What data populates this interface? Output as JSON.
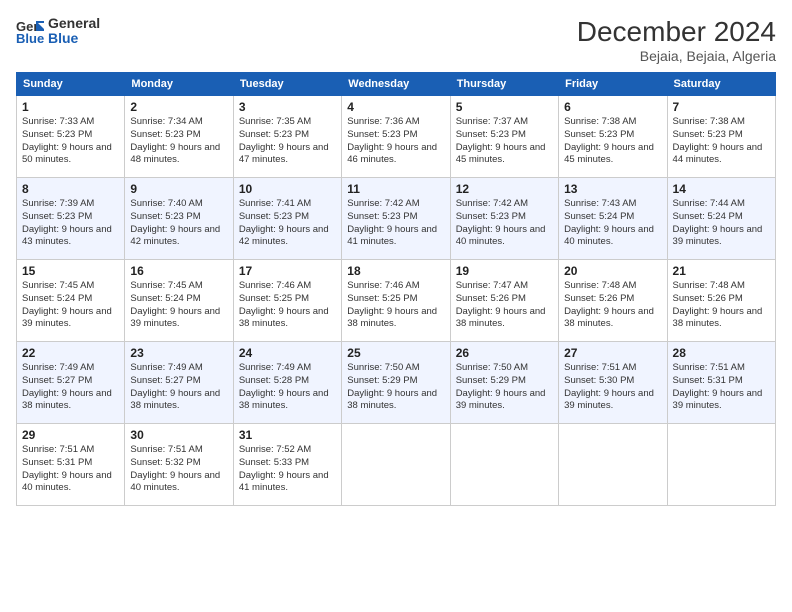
{
  "logo": {
    "line1": "General",
    "line2": "Blue"
  },
  "header": {
    "month": "December 2024",
    "location": "Bejaia, Bejaia, Algeria"
  },
  "weekdays": [
    "Sunday",
    "Monday",
    "Tuesday",
    "Wednesday",
    "Thursday",
    "Friday",
    "Saturday"
  ],
  "weeks": [
    [
      {
        "day": "1",
        "sunrise": "Sunrise: 7:33 AM",
        "sunset": "Sunset: 5:23 PM",
        "daylight": "Daylight: 9 hours and 50 minutes."
      },
      {
        "day": "2",
        "sunrise": "Sunrise: 7:34 AM",
        "sunset": "Sunset: 5:23 PM",
        "daylight": "Daylight: 9 hours and 48 minutes."
      },
      {
        "day": "3",
        "sunrise": "Sunrise: 7:35 AM",
        "sunset": "Sunset: 5:23 PM",
        "daylight": "Daylight: 9 hours and 47 minutes."
      },
      {
        "day": "4",
        "sunrise": "Sunrise: 7:36 AM",
        "sunset": "Sunset: 5:23 PM",
        "daylight": "Daylight: 9 hours and 46 minutes."
      },
      {
        "day": "5",
        "sunrise": "Sunrise: 7:37 AM",
        "sunset": "Sunset: 5:23 PM",
        "daylight": "Daylight: 9 hours and 45 minutes."
      },
      {
        "day": "6",
        "sunrise": "Sunrise: 7:38 AM",
        "sunset": "Sunset: 5:23 PM",
        "daylight": "Daylight: 9 hours and 45 minutes."
      },
      {
        "day": "7",
        "sunrise": "Sunrise: 7:38 AM",
        "sunset": "Sunset: 5:23 PM",
        "daylight": "Daylight: 9 hours and 44 minutes."
      }
    ],
    [
      {
        "day": "8",
        "sunrise": "Sunrise: 7:39 AM",
        "sunset": "Sunset: 5:23 PM",
        "daylight": "Daylight: 9 hours and 43 minutes."
      },
      {
        "day": "9",
        "sunrise": "Sunrise: 7:40 AM",
        "sunset": "Sunset: 5:23 PM",
        "daylight": "Daylight: 9 hours and 42 minutes."
      },
      {
        "day": "10",
        "sunrise": "Sunrise: 7:41 AM",
        "sunset": "Sunset: 5:23 PM",
        "daylight": "Daylight: 9 hours and 42 minutes."
      },
      {
        "day": "11",
        "sunrise": "Sunrise: 7:42 AM",
        "sunset": "Sunset: 5:23 PM",
        "daylight": "Daylight: 9 hours and 41 minutes."
      },
      {
        "day": "12",
        "sunrise": "Sunrise: 7:42 AM",
        "sunset": "Sunset: 5:23 PM",
        "daylight": "Daylight: 9 hours and 40 minutes."
      },
      {
        "day": "13",
        "sunrise": "Sunrise: 7:43 AM",
        "sunset": "Sunset: 5:24 PM",
        "daylight": "Daylight: 9 hours and 40 minutes."
      },
      {
        "day": "14",
        "sunrise": "Sunrise: 7:44 AM",
        "sunset": "Sunset: 5:24 PM",
        "daylight": "Daylight: 9 hours and 39 minutes."
      }
    ],
    [
      {
        "day": "15",
        "sunrise": "Sunrise: 7:45 AM",
        "sunset": "Sunset: 5:24 PM",
        "daylight": "Daylight: 9 hours and 39 minutes."
      },
      {
        "day": "16",
        "sunrise": "Sunrise: 7:45 AM",
        "sunset": "Sunset: 5:24 PM",
        "daylight": "Daylight: 9 hours and 39 minutes."
      },
      {
        "day": "17",
        "sunrise": "Sunrise: 7:46 AM",
        "sunset": "Sunset: 5:25 PM",
        "daylight": "Daylight: 9 hours and 38 minutes."
      },
      {
        "day": "18",
        "sunrise": "Sunrise: 7:46 AM",
        "sunset": "Sunset: 5:25 PM",
        "daylight": "Daylight: 9 hours and 38 minutes."
      },
      {
        "day": "19",
        "sunrise": "Sunrise: 7:47 AM",
        "sunset": "Sunset: 5:26 PM",
        "daylight": "Daylight: 9 hours and 38 minutes."
      },
      {
        "day": "20",
        "sunrise": "Sunrise: 7:48 AM",
        "sunset": "Sunset: 5:26 PM",
        "daylight": "Daylight: 9 hours and 38 minutes."
      },
      {
        "day": "21",
        "sunrise": "Sunrise: 7:48 AM",
        "sunset": "Sunset: 5:26 PM",
        "daylight": "Daylight: 9 hours and 38 minutes."
      }
    ],
    [
      {
        "day": "22",
        "sunrise": "Sunrise: 7:49 AM",
        "sunset": "Sunset: 5:27 PM",
        "daylight": "Daylight: 9 hours and 38 minutes."
      },
      {
        "day": "23",
        "sunrise": "Sunrise: 7:49 AM",
        "sunset": "Sunset: 5:27 PM",
        "daylight": "Daylight: 9 hours and 38 minutes."
      },
      {
        "day": "24",
        "sunrise": "Sunrise: 7:49 AM",
        "sunset": "Sunset: 5:28 PM",
        "daylight": "Daylight: 9 hours and 38 minutes."
      },
      {
        "day": "25",
        "sunrise": "Sunrise: 7:50 AM",
        "sunset": "Sunset: 5:29 PM",
        "daylight": "Daylight: 9 hours and 38 minutes."
      },
      {
        "day": "26",
        "sunrise": "Sunrise: 7:50 AM",
        "sunset": "Sunset: 5:29 PM",
        "daylight": "Daylight: 9 hours and 39 minutes."
      },
      {
        "day": "27",
        "sunrise": "Sunrise: 7:51 AM",
        "sunset": "Sunset: 5:30 PM",
        "daylight": "Daylight: 9 hours and 39 minutes."
      },
      {
        "day": "28",
        "sunrise": "Sunrise: 7:51 AM",
        "sunset": "Sunset: 5:31 PM",
        "daylight": "Daylight: 9 hours and 39 minutes."
      }
    ],
    [
      {
        "day": "29",
        "sunrise": "Sunrise: 7:51 AM",
        "sunset": "Sunset: 5:31 PM",
        "daylight": "Daylight: 9 hours and 40 minutes."
      },
      {
        "day": "30",
        "sunrise": "Sunrise: 7:51 AM",
        "sunset": "Sunset: 5:32 PM",
        "daylight": "Daylight: 9 hours and 40 minutes."
      },
      {
        "day": "31",
        "sunrise": "Sunrise: 7:52 AM",
        "sunset": "Sunset: 5:33 PM",
        "daylight": "Daylight: 9 hours and 41 minutes."
      },
      null,
      null,
      null,
      null
    ]
  ]
}
